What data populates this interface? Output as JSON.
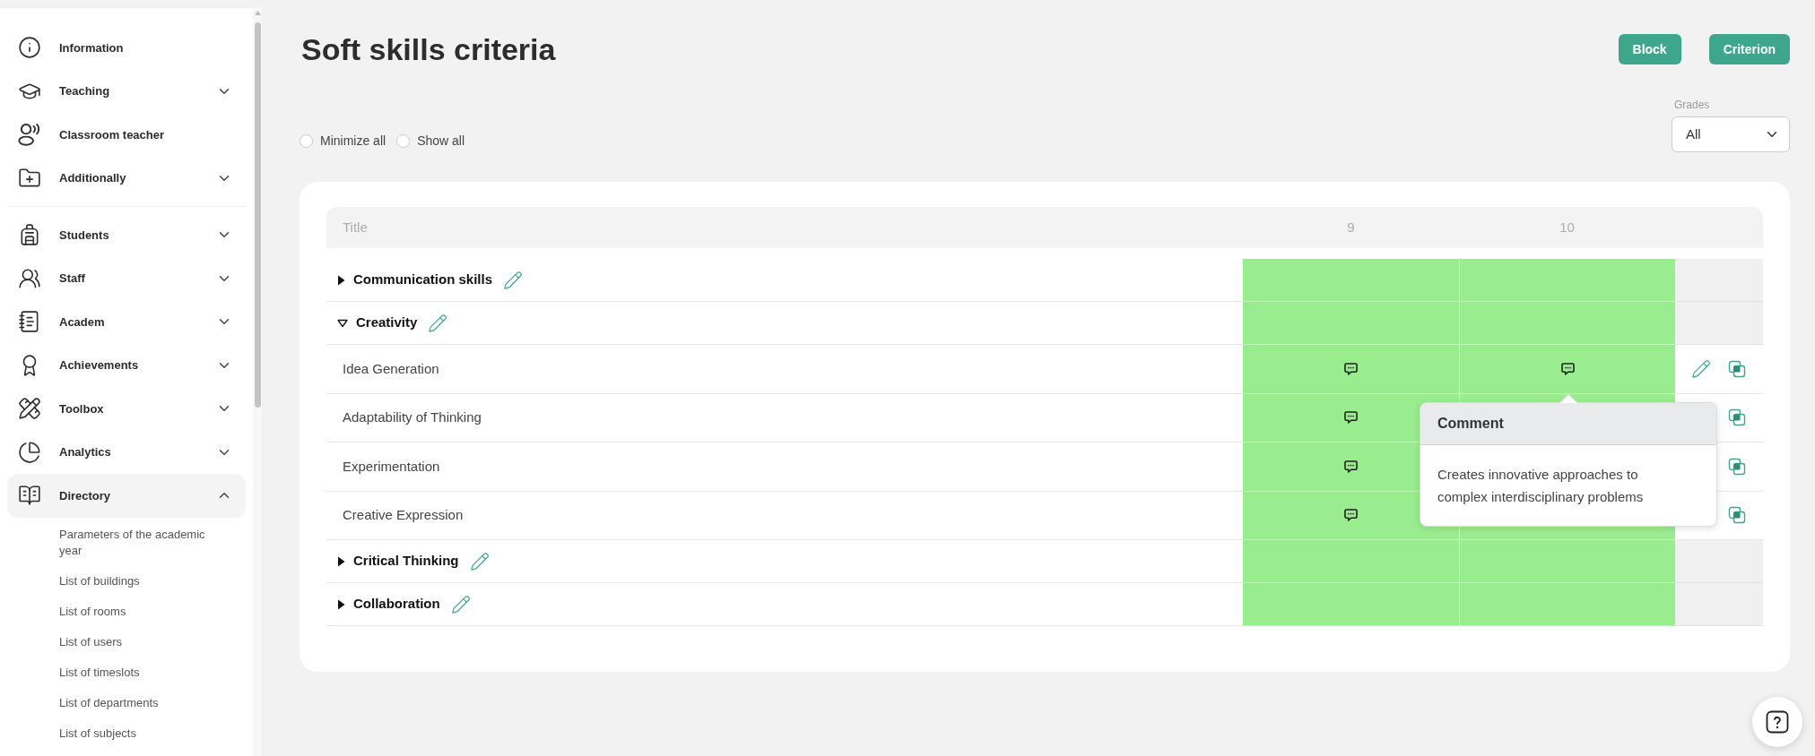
{
  "sidebar": {
    "sections": [
      {
        "items": [
          {
            "label": "Information"
          },
          {
            "label": "Teaching",
            "expanded": false
          },
          {
            "label": "Classroom teacher"
          },
          {
            "label": "Additionally",
            "expanded": false
          }
        ]
      },
      {
        "items": [
          {
            "label": "Students",
            "expanded": false
          },
          {
            "label": "Staff",
            "expanded": false
          },
          {
            "label": "Academ",
            "expanded": false
          },
          {
            "label": "Achievements",
            "expanded": false
          },
          {
            "label": "Toolbox",
            "expanded": false
          },
          {
            "label": "Analytics",
            "expanded": false
          },
          {
            "label": "Directory",
            "expanded": true,
            "children": [
              {
                "label": "Parameters of the academic year"
              },
              {
                "label": "List of buildings"
              },
              {
                "label": "List of rooms"
              },
              {
                "label": "List of users"
              },
              {
                "label": "List of timeslots"
              },
              {
                "label": "List of departments"
              },
              {
                "label": "List of subjects"
              }
            ]
          }
        ]
      }
    ]
  },
  "page": {
    "title": "Soft skills criteria",
    "buttons": [
      {
        "label": "Block"
      },
      {
        "label": "Criterion"
      }
    ]
  },
  "view_options": [
    {
      "label": "Minimize all",
      "selected": false
    },
    {
      "label": "Show all",
      "selected": false
    }
  ],
  "grades_filter": {
    "label": "Grades",
    "value": "All"
  },
  "table": {
    "columns": [
      "Title",
      "9",
      "10"
    ],
    "rows": [
      {
        "title": "Communication skills",
        "expanded": false
      },
      {
        "title": "Creativity",
        "expanded": true,
        "children": [
          {
            "title": "Idea Generation",
            "cells": [
              {
                "comment": true
              },
              {
                "comment": true,
                "tooltip": {
                  "title": "Comment",
                  "text": "Creates innovative approaches to complex interdisciplinary problems"
                }
              }
            ],
            "actions": [
              {
                "kind": "edit"
              },
              {
                "kind": "copy"
              }
            ]
          },
          {
            "title": "Adaptability of Thinking",
            "cells": [
              {
                "comment": true
              }
            ],
            "actions": [
              {
                "kind": "copy"
              }
            ]
          },
          {
            "title": "Experimentation",
            "cells": [
              {
                "comment": true
              }
            ],
            "actions": [
              {
                "kind": "copy"
              }
            ]
          },
          {
            "title": "Creative Expression",
            "cells": [
              {
                "comment": true
              }
            ],
            "actions": [
              {
                "kind": "copy"
              }
            ]
          }
        ]
      },
      {
        "title": "Critical Thinking",
        "expanded": false
      },
      {
        "title": "Collaboration",
        "expanded": false
      }
    ]
  }
}
